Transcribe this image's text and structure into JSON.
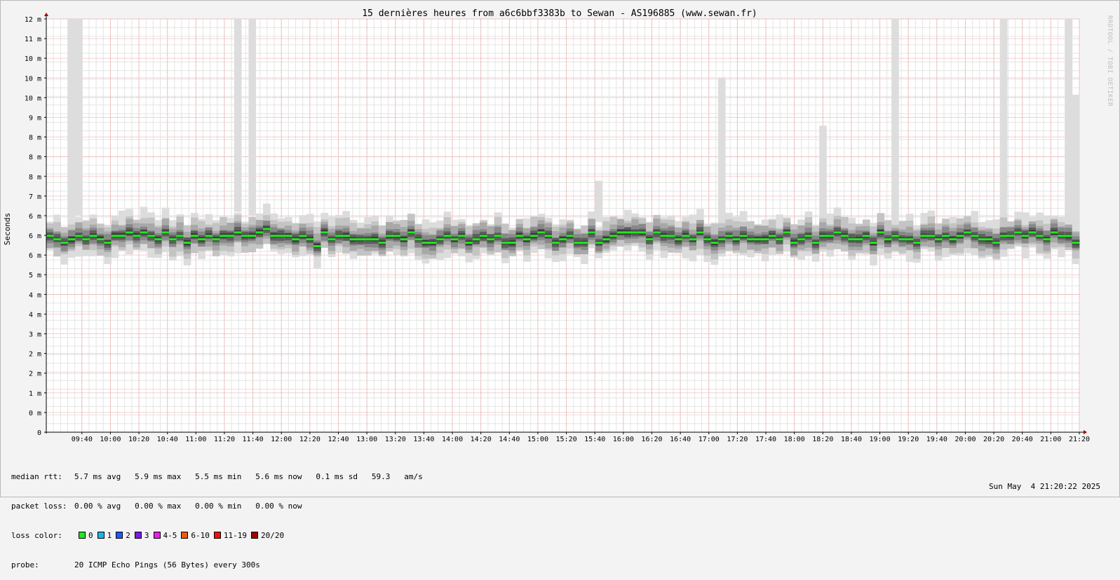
{
  "chart_data": {
    "type": "area",
    "title": "15 dernières heures from a6c6bbf3383b to Sewan - AS196885 (www.sewan.fr)",
    "ylabel": "Seconds",
    "ylim": [
      0,
      12
    ],
    "y_ticks": [
      "0",
      "0 m",
      "1 m",
      "2 m",
      "2 m",
      "3 m",
      "4 m",
      "4 m",
      "5 m",
      "6 m",
      "6 m",
      "6 m",
      "7 m",
      "8 m",
      "8 m",
      "8 m",
      "9 m",
      "10 m",
      "10 m",
      "10 m",
      "11 m",
      "12 m"
    ],
    "x_ticks": [
      "09:40",
      "10:00",
      "10:20",
      "10:40",
      "11:00",
      "11:20",
      "11:40",
      "12:00",
      "12:20",
      "12:40",
      "13:00",
      "13:20",
      "13:40",
      "14:00",
      "14:20",
      "14:40",
      "15:00",
      "15:20",
      "15:40",
      "16:00",
      "16:20",
      "16:40",
      "17:00",
      "17:20",
      "17:40",
      "18:00",
      "18:20",
      "18:40",
      "19:00",
      "19:20",
      "19:40",
      "20:00",
      "20:20",
      "20:40",
      "21:00",
      "21:20"
    ],
    "grid": true,
    "series": [
      {
        "name": "median rtt",
        "color": "#22e622",
        "values": [
          5.7,
          5.6,
          5.5,
          5.6,
          5.7,
          5.6,
          5.7,
          5.6,
          5.5,
          5.7,
          5.7,
          5.8,
          5.7,
          5.8,
          5.7,
          5.6,
          5.8,
          5.6,
          5.7,
          5.5,
          5.7,
          5.6,
          5.7,
          5.6,
          5.7,
          5.7,
          5.8,
          5.7,
          5.7,
          5.8,
          5.9,
          5.7,
          5.7,
          5.7,
          5.6,
          5.7,
          5.6,
          5.4,
          5.8,
          5.6,
          5.7,
          5.7,
          5.6,
          5.6,
          5.6,
          5.6,
          5.5,
          5.7,
          5.7,
          5.6,
          5.8,
          5.6,
          5.5,
          5.5,
          5.6,
          5.7,
          5.6,
          5.7,
          5.5,
          5.6,
          5.7,
          5.6,
          5.7,
          5.5,
          5.5,
          5.7,
          5.6,
          5.7,
          5.8,
          5.7,
          5.5,
          5.6,
          5.7,
          5.5,
          5.5,
          5.8,
          5.5,
          5.6,
          5.7,
          5.8,
          5.8,
          5.8,
          5.8,
          5.6,
          5.8,
          5.7,
          5.7,
          5.6,
          5.7,
          5.6,
          5.8,
          5.6,
          5.5,
          5.6,
          5.7,
          5.6,
          5.7,
          5.6,
          5.6,
          5.6,
          5.7,
          5.6,
          5.8,
          5.5,
          5.6,
          5.7,
          5.5,
          5.7,
          5.7,
          5.8,
          5.7,
          5.6,
          5.6,
          5.7,
          5.5,
          5.8,
          5.6,
          5.7,
          5.6,
          5.6,
          5.5,
          5.7,
          5.7,
          5.6,
          5.7,
          5.6,
          5.7,
          5.8,
          5.7,
          5.6,
          5.6,
          5.5,
          5.7,
          5.7,
          5.8,
          5.7,
          5.8,
          5.7,
          5.6,
          5.8,
          5.7,
          5.7,
          5.5
        ]
      }
    ],
    "spikes": [
      {
        "time": "09:30",
        "max": 12.0
      },
      {
        "time": "09:35",
        "max": 12.0
      },
      {
        "time": "11:25",
        "max": 12.0
      },
      {
        "time": "11:35",
        "max": 12.0
      },
      {
        "time": "15:35",
        "max": 7.3
      },
      {
        "time": "17:00",
        "max": 10.3
      },
      {
        "time": "18:10",
        "max": 8.9
      },
      {
        "time": "19:00",
        "max": 12.0
      },
      {
        "time": "20:15",
        "max": 12.0
      },
      {
        "time": "21:00",
        "max": 12.0
      },
      {
        "time": "21:05",
        "max": 9.8
      }
    ],
    "loss_color_legend": [
      {
        "label": "0",
        "color": "#22e622"
      },
      {
        "label": "1",
        "color": "#20b4e6"
      },
      {
        "label": "2",
        "color": "#1e5ef0"
      },
      {
        "label": "3",
        "color": "#7a1ee6"
      },
      {
        "label": "4-5",
        "color": "#e620e6"
      },
      {
        "label": "6-10",
        "color": "#ee5a10"
      },
      {
        "label": "11-19",
        "color": "#ee1010"
      },
      {
        "label": "20/20",
        "color": "#a00000"
      }
    ]
  },
  "stats": {
    "median_rtt_label": "median rtt:",
    "median_rtt_values": "5.7 ms avg   5.9 ms max   5.5 ms min   5.6 ms now   0.1 ms sd   59.3   am/s",
    "packet_loss_label": "packet loss:",
    "packet_loss_values": "0.00 % avg   0.00 % max   0.00 % min   0.00 % now",
    "loss_color_label": "loss color:",
    "probe_label": "probe:",
    "probe_value": "20 ICMP Echo Pings (56 Bytes) every 300s"
  },
  "timestamp": "Sun May  4 21:20:22 2025",
  "watermark": "RRDTOOL / TOBI OETIKER"
}
